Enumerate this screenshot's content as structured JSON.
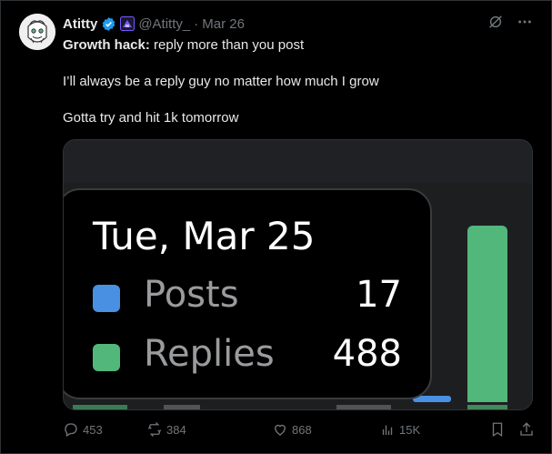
{
  "tweet": {
    "display_name": "Atitty",
    "handle": "@Atitty_",
    "separator": "·",
    "date": "Mar 26",
    "body": {
      "line1_bold": "Growth hack:",
      "line1_rest": " reply more than you post",
      "line2": "I’ll always be a reply guy no matter how much I grow",
      "line3": "Gotta try and hit 1k tomorrow"
    },
    "media": {
      "tooltip_date": "Tue, Mar 25",
      "rows": [
        {
          "label": "Posts",
          "value": "17",
          "color": "#4a90e2"
        },
        {
          "label": "Replies",
          "value": "488",
          "color": "#52b77a"
        }
      ]
    },
    "actions": {
      "replies": "453",
      "reposts": "384",
      "likes": "868",
      "views": "15K"
    }
  },
  "colors": {
    "accent_blue": "#1d9bf0",
    "affiliate_purple": "#7856ff",
    "muted": "#71767b"
  }
}
